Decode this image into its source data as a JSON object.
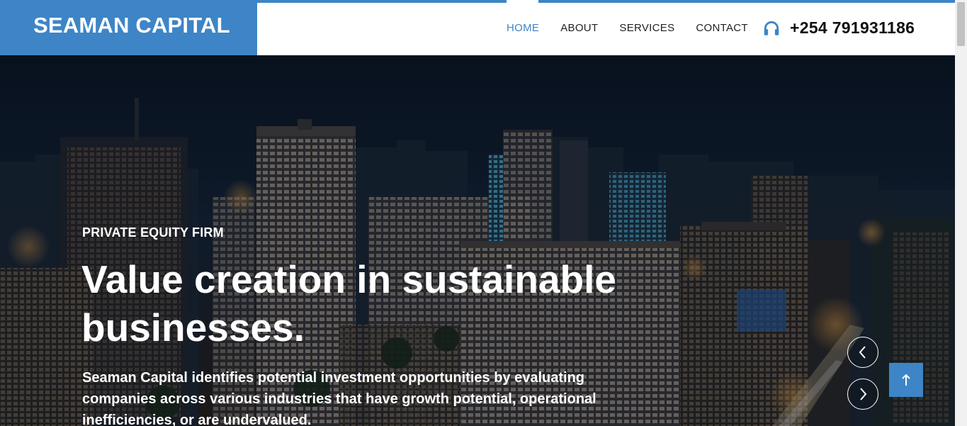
{
  "brand": {
    "name": "SEAMAN CAPITAL"
  },
  "nav": {
    "items": [
      {
        "label": "HOME",
        "active": true
      },
      {
        "label": "ABOUT"
      },
      {
        "label": "SERVICES"
      },
      {
        "label": "CONTACT"
      }
    ]
  },
  "contact": {
    "icon": "headphones-icon",
    "phone": "+254 791931186"
  },
  "hero": {
    "eyebrow": "PRIVATE EQUITY FIRM",
    "headline": "Value creation in sustainable businesses.",
    "description": "Seaman Capital identifies potential investment opportunities by evaluating companies across various industries that have growth potential, operational inefficiencies, or are undervalued."
  },
  "controls": {
    "prev_icon": "chevron-left-icon",
    "next_icon": "chevron-right-icon",
    "top_icon": "arrow-up-icon"
  },
  "colors": {
    "accent": "#3d85c6",
    "nav_text": "#222222",
    "hero_text": "#ffffff"
  }
}
